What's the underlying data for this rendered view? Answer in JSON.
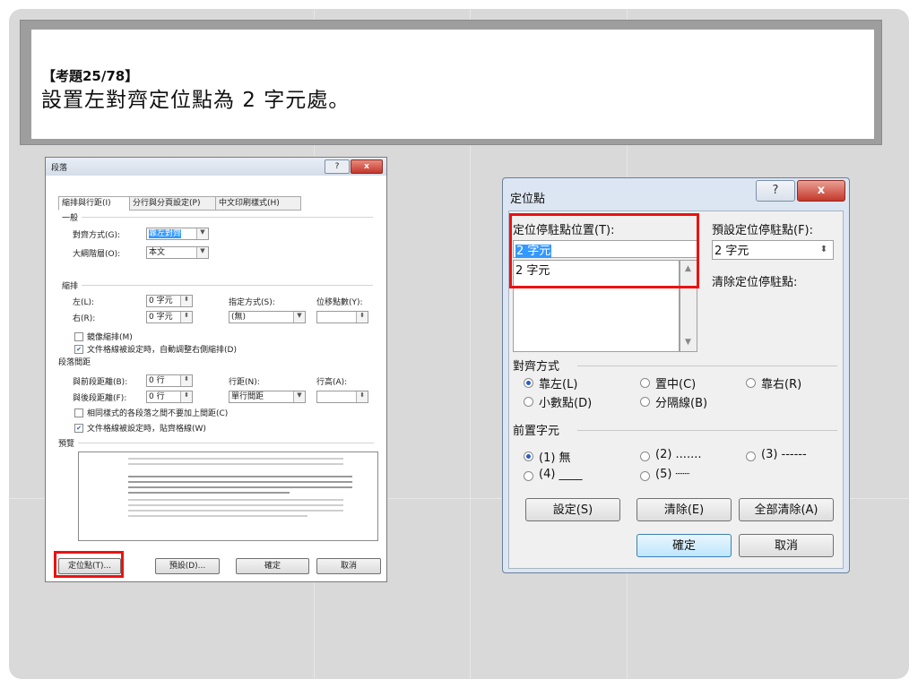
{
  "slide": {
    "question_number": "【考題25/78】",
    "question_text": "設置左對齊定位點為 2 字元處。"
  },
  "paragraph_dialog": {
    "title": "段落",
    "help": "?",
    "close": "x",
    "tabs": [
      "縮排與行距(I)",
      "分行與分頁設定(P)",
      "中文印刷樣式(H)"
    ],
    "general_label": "一般",
    "alignment_label": "對齊方式(G):",
    "alignment_value": "靠左對齊",
    "outline_label": "大綱階層(O):",
    "outline_value": "本文",
    "indent_label": "縮排",
    "left_label": "左(L):",
    "left_value": "0 字元",
    "right_label": "右(R):",
    "right_value": "0 字元",
    "special_label": "指定方式(S):",
    "special_value": "(無)",
    "by_label": "位移點數(Y):",
    "mirror_label": "鏡像縮排(M)",
    "auto_indent_label": "文件格線被設定時，自動調整右側縮排(D)",
    "spacing_label": "段落間距",
    "before_label": "與前段距離(B):",
    "before_value": "0 行",
    "after_label": "與後段距離(F):",
    "after_value": "0 行",
    "line_spacing_label": "行距(N):",
    "line_spacing_value": "單行間距",
    "at_label": "行高(A):",
    "no_space_label": "相同樣式的各段落之間不要加上間距(C)",
    "snap_grid_label": "文件格線被設定時，貼齊格線(W)",
    "preview_label": "預覽",
    "btn_tabs": "定位點(T)...",
    "btn_default": "預設(D)...",
    "btn_ok": "確定",
    "btn_cancel": "取消"
  },
  "tabs_dialog": {
    "title": "定位點",
    "help": "?",
    "close": "x",
    "tab_stop_label": "定位停駐點位置(T):",
    "tab_stop_value": "2 字元",
    "tab_stop_list": [
      "2 字元"
    ],
    "default_tab_label": "預設定位停駐點(F):",
    "default_tab_value": "2 字元",
    "clear_label": "清除定位停駐點:",
    "alignment_label": "對齊方式",
    "align_left": "靠左(L)",
    "align_center": "置中(C)",
    "align_right": "靠右(R)",
    "align_decimal": "小數點(D)",
    "align_bar": "分隔線(B)",
    "leader_label": "前置字元",
    "leader_1": "(1)  無",
    "leader_2": "(2) .......",
    "leader_3": "(3) ------",
    "leader_4": "(4) ____",
    "leader_5": "(5) ┈┈",
    "btn_set": "設定(S)",
    "btn_clear": "清除(E)",
    "btn_clear_all": "全部清除(A)",
    "btn_ok": "確定",
    "btn_cancel": "取消"
  }
}
